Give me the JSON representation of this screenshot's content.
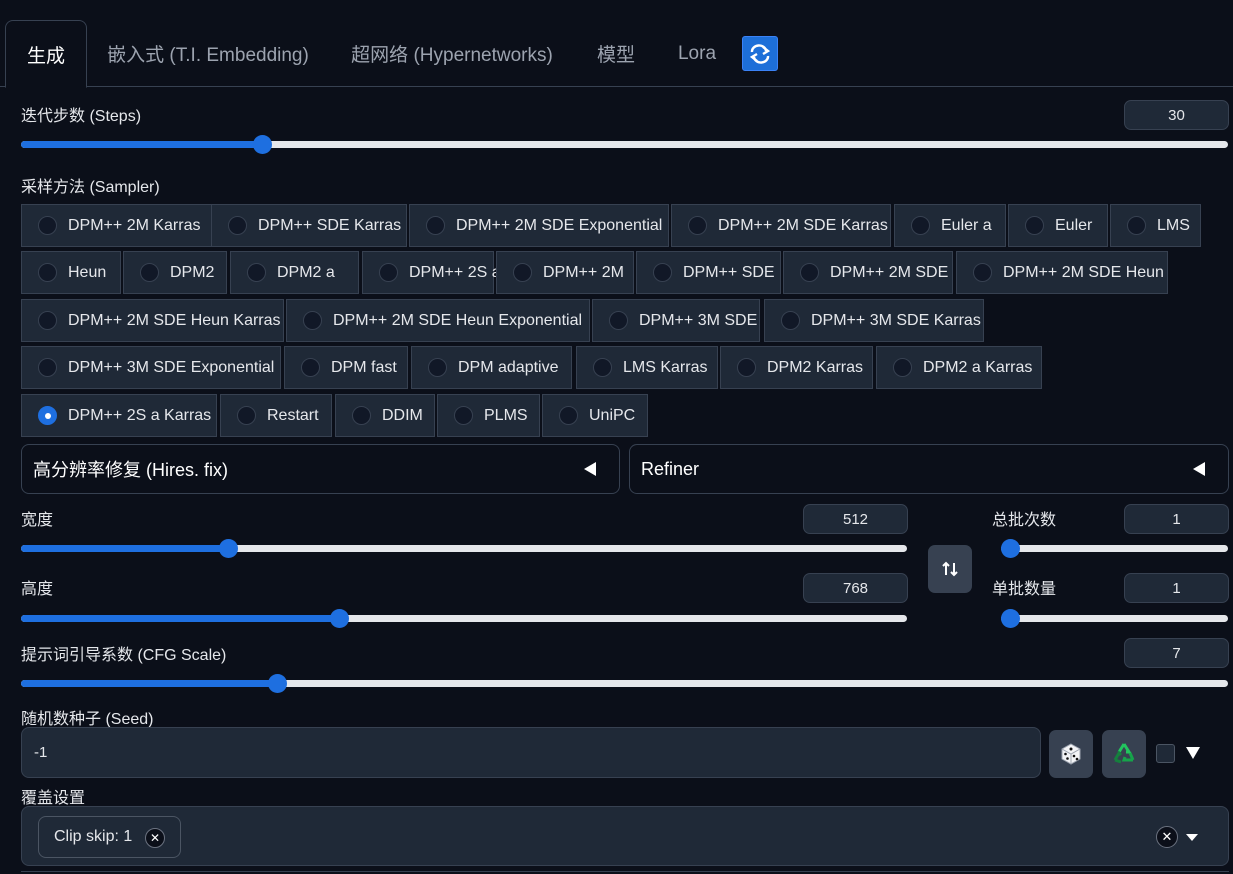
{
  "tabs": [
    {
      "label": "生成"
    },
    {
      "label": "嵌入式 (T.I. Embedding)"
    },
    {
      "label": "超网络 (Hypernetworks)"
    },
    {
      "label": "模型"
    },
    {
      "label": "Lora"
    }
  ],
  "steps": {
    "label": "迭代步数 (Steps)",
    "value": "30",
    "fraction": 0.2
  },
  "sampler": {
    "label": "采样方法 (Sampler)",
    "selected": "DPM++ 2S a Karras",
    "options": [
      "DPM++ 2M Karras",
      "DPM++ SDE Karras",
      "DPM++ 2M SDE Exponential",
      "DPM++ 2M SDE Karras",
      "Euler a",
      "Euler",
      "LMS",
      "Heun",
      "DPM2",
      "DPM2 a",
      "DPM++ 2S a",
      "DPM++ 2M",
      "DPM++ SDE",
      "DPM++ 2M SDE",
      "DPM++ 2M SDE Heun",
      "DPM++ 2M SDE Heun Karras",
      "DPM++ 2M SDE Heun Exponential",
      "DPM++ 3M SDE",
      "DPM++ 3M SDE Karras",
      "DPM++ 3M SDE Exponential",
      "DPM fast",
      "DPM adaptive",
      "LMS Karras",
      "DPM2 Karras",
      "DPM2 a Karras",
      "DPM++ 2S a Karras",
      "Restart",
      "DDIM",
      "PLMS",
      "UniPC"
    ]
  },
  "hires": {
    "label": "高分辨率修复 (Hires. fix)"
  },
  "refiner": {
    "label": "Refiner"
  },
  "width": {
    "label": "宽度",
    "value": "512",
    "fraction": 0.234
  },
  "height": {
    "label": "高度",
    "value": "768",
    "fraction": 0.359
  },
  "batch_count": {
    "label": "总批次数",
    "value": "1",
    "fraction": 0.0
  },
  "batch_size": {
    "label": "单批数量",
    "value": "1",
    "fraction": 0.0
  },
  "cfg": {
    "label": "提示词引导系数 (CFG Scale)",
    "value": "7",
    "fraction": 0.212
  },
  "seed": {
    "label": "随机数种子 (Seed)",
    "value": "-1"
  },
  "override": {
    "label": "覆盖设置",
    "chip": "Clip skip: 1"
  },
  "icons": {
    "tab_refresh": "refresh-icon",
    "swap": "swap-arrows-icon",
    "dice": "dice-icon",
    "recycle": "recycle-icon",
    "collapse": "triangle-left-icon"
  },
  "colors": {
    "accent": "#1e6fe0",
    "background": "#0b0f19",
    "panel": "#1f2937",
    "border": "#374151"
  }
}
